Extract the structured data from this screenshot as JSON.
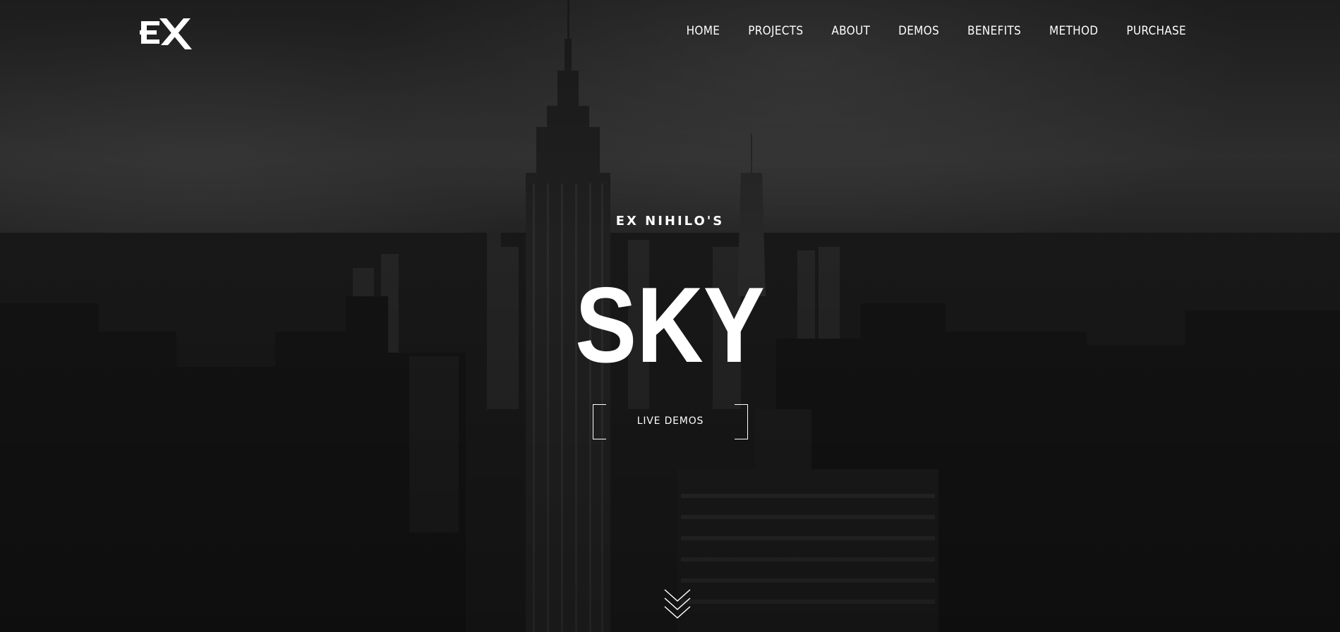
{
  "brand": {
    "logo_text": "EX"
  },
  "nav": {
    "items": [
      "HOME",
      "PROJECTS",
      "ABOUT",
      "DEMOS",
      "BENEFITS",
      "METHOD",
      "PURCHASE"
    ]
  },
  "hero": {
    "kicker": "EX NIHILO'S",
    "title": "SKY",
    "cta_label": "LIVE DEMOS"
  },
  "icons": {
    "scroll": "chevron-down-icon"
  }
}
